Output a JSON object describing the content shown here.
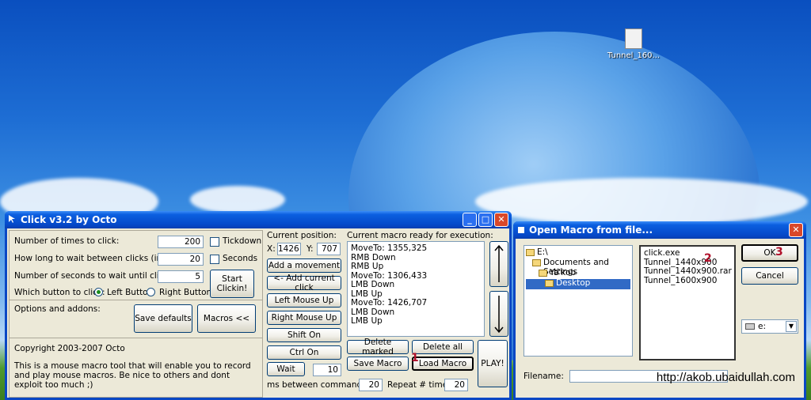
{
  "desktop": {
    "icon_label": "Tunnel_160...",
    "watermark": "http://akob.ubaidullah.com"
  },
  "click_window": {
    "title": "Click v3.2 by Octo",
    "labels": {
      "times": "Number of times to click:",
      "wait": "How long to wait between clicks (in ms):",
      "seconds": "Number of seconds to wait until clicking:",
      "which": "Which button to click:",
      "options": "Options and addons:",
      "copyright": "Copyright 2003-2007 Octo",
      "desc": "This is a mouse macro tool that will enable you to record and play mouse macros. Be nice to others and dont exploit too much ;)",
      "current_pos": "Current position:",
      "x": "X:",
      "y": "Y:",
      "macro_ready": "Current macro ready for execution:",
      "ms_between": "ms between commands::",
      "repeat": "Repeat # times:"
    },
    "values": {
      "times": "200",
      "wait": "20",
      "seconds": "5",
      "pos_x": "1426",
      "pos_y": "707",
      "wait_cmd": "10",
      "ms_between": "20",
      "repeat": "20"
    },
    "checks": {
      "tickdown": "Tickdown",
      "seconds": "Seconds"
    },
    "radios": {
      "left": "Left Button",
      "right": "Right Button"
    },
    "buttons": {
      "start": "Start Clickin!",
      "save_defaults": "Save defaults",
      "macros": "Macros <<",
      "add_movement": "Add a movement",
      "add_current": "<- Add current click",
      "left_up": "Left Mouse Up",
      "right_up": "Right Mouse Up",
      "shift_on": "Shift On",
      "ctrl_on": "Ctrl On",
      "wait": "Wait",
      "delete_marked": "Delete marked",
      "delete_all": "Delete all",
      "save_macro": "Save Macro",
      "load_macro": "Load Macro",
      "play": "PLAY!"
    },
    "macro_lines": [
      "MoveTo: 1355,325",
      "RMB Down",
      "RMB Up",
      "MoveTo: 1306,433",
      "LMB Down",
      "LMB Up",
      "MoveTo: 1426,707",
      "LMB Down",
      "LMB Up"
    ],
    "annotation": "1"
  },
  "open_dialog": {
    "title": "Open Macro from file...",
    "folders": [
      "E:\\",
      "Documents and Settings",
      "Ya'kob",
      "Desktop"
    ],
    "files": [
      "click.exe",
      "Tunnel_1440x900",
      "Tunnel_1440x900.rar",
      "Tunnel_1600x900"
    ],
    "ok": "OK",
    "cancel": "Cancel",
    "drive": "e:",
    "filename_label": "Filename:",
    "annot_2": "2",
    "annot_3": "3"
  }
}
